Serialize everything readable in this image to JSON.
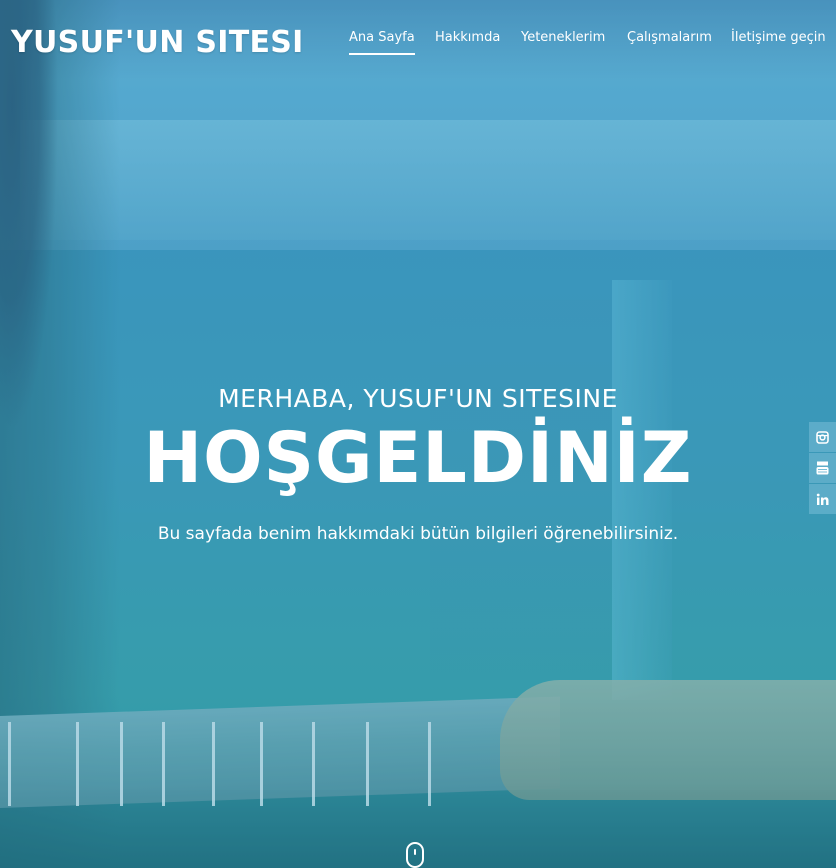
{
  "site": {
    "title": "YUSUF'UN SITESI"
  },
  "nav": {
    "items": [
      {
        "label": "Ana Sayfa",
        "active": true
      },
      {
        "label": "Hakkımda",
        "active": false
      },
      {
        "label": "Yeteneklerim",
        "active": false
      },
      {
        "label": "Çalışmalarım",
        "active": false
      },
      {
        "label": "İletişime geçin",
        "active": false
      }
    ]
  },
  "hero": {
    "subtitle": "MERHABA, YUSUF'UN SITESINE",
    "title": "HOŞGELDİNİZ",
    "description": "Bu sayfada benim hakkımdaki bütün bilgileri öğrenebilirsiniz."
  },
  "social": {
    "icons": [
      "instagram-icon",
      "youtube-icon",
      "linkedin-icon"
    ]
  },
  "colors": {
    "text": "#ffffff",
    "overlay": "#3f9cc0",
    "social_bg": "#78bed7"
  }
}
